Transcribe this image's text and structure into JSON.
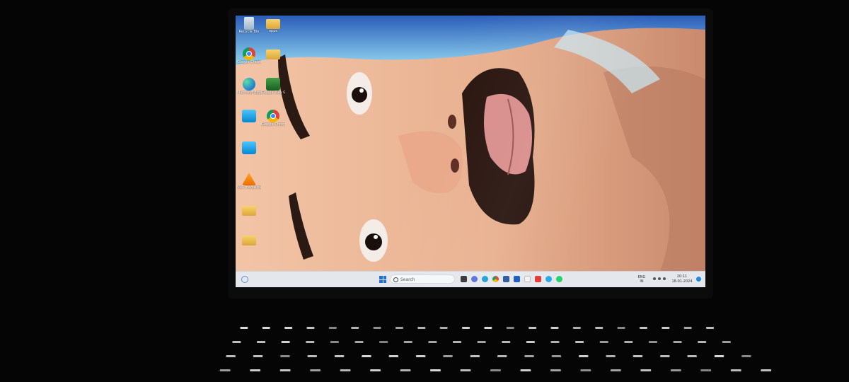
{
  "desktop": {
    "icons": [
      {
        "label": "Recycle Bin",
        "icon": "recycle-bin-icon"
      },
      {
        "label": "apps",
        "icon": "folder-icon"
      },
      {
        "label": "Google Chrome",
        "icon": "chrome-icon"
      },
      {
        "label": "",
        "icon": "folder-icon"
      },
      {
        "label": "Microsoft Edge",
        "icon": "edge-icon"
      },
      {
        "label": "Google Play Games",
        "icon": "play-games-icon"
      },
      {
        "label": "",
        "icon": "app-icon"
      },
      {
        "label": "Google Chrome",
        "icon": "chrome-icon"
      },
      {
        "label": "",
        "icon": "app-icon"
      },
      {
        "label": "VLC media player",
        "icon": "vlc-icon"
      },
      {
        "label": "",
        "icon": "folder-icon"
      },
      {
        "label": "",
        "icon": "folder-icon"
      }
    ]
  },
  "taskbar": {
    "search_placeholder": "Search",
    "apps": [
      "file-explorer-icon",
      "chat-icon",
      "edge-icon",
      "chrome-icon",
      "store-icon",
      "word-icon",
      "mail-icon",
      "youtube-icon",
      "telegram-icon",
      "whatsapp-icon"
    ],
    "tray": {
      "lang": "ENG\nIN",
      "time": "20:11",
      "date": "18-01-2024"
    }
  },
  "colors": {
    "taskbar": "#e4e7ec",
    "accent": "#1e6fd9"
  }
}
